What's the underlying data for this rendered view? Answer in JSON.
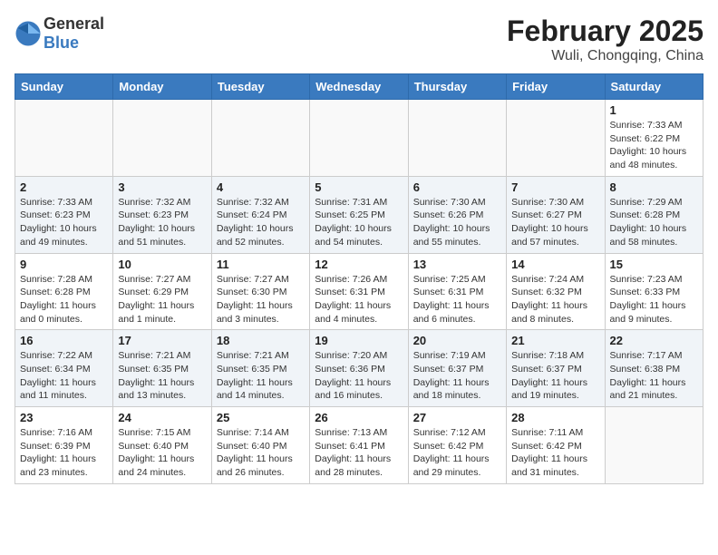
{
  "header": {
    "logo_general": "General",
    "logo_blue": "Blue",
    "month": "February 2025",
    "location": "Wuli, Chongqing, China"
  },
  "weekdays": [
    "Sunday",
    "Monday",
    "Tuesday",
    "Wednesday",
    "Thursday",
    "Friday",
    "Saturday"
  ],
  "weeks": [
    [
      {
        "day": "",
        "info": ""
      },
      {
        "day": "",
        "info": ""
      },
      {
        "day": "",
        "info": ""
      },
      {
        "day": "",
        "info": ""
      },
      {
        "day": "",
        "info": ""
      },
      {
        "day": "",
        "info": ""
      },
      {
        "day": "1",
        "info": "Sunrise: 7:33 AM\nSunset: 6:22 PM\nDaylight: 10 hours and 48 minutes."
      }
    ],
    [
      {
        "day": "2",
        "info": "Sunrise: 7:33 AM\nSunset: 6:23 PM\nDaylight: 10 hours and 49 minutes."
      },
      {
        "day": "3",
        "info": "Sunrise: 7:32 AM\nSunset: 6:23 PM\nDaylight: 10 hours and 51 minutes."
      },
      {
        "day": "4",
        "info": "Sunrise: 7:32 AM\nSunset: 6:24 PM\nDaylight: 10 hours and 52 minutes."
      },
      {
        "day": "5",
        "info": "Sunrise: 7:31 AM\nSunset: 6:25 PM\nDaylight: 10 hours and 54 minutes."
      },
      {
        "day": "6",
        "info": "Sunrise: 7:30 AM\nSunset: 6:26 PM\nDaylight: 10 hours and 55 minutes."
      },
      {
        "day": "7",
        "info": "Sunrise: 7:30 AM\nSunset: 6:27 PM\nDaylight: 10 hours and 57 minutes."
      },
      {
        "day": "8",
        "info": "Sunrise: 7:29 AM\nSunset: 6:28 PM\nDaylight: 10 hours and 58 minutes."
      }
    ],
    [
      {
        "day": "9",
        "info": "Sunrise: 7:28 AM\nSunset: 6:28 PM\nDaylight: 11 hours and 0 minutes."
      },
      {
        "day": "10",
        "info": "Sunrise: 7:27 AM\nSunset: 6:29 PM\nDaylight: 11 hours and 1 minute."
      },
      {
        "day": "11",
        "info": "Sunrise: 7:27 AM\nSunset: 6:30 PM\nDaylight: 11 hours and 3 minutes."
      },
      {
        "day": "12",
        "info": "Sunrise: 7:26 AM\nSunset: 6:31 PM\nDaylight: 11 hours and 4 minutes."
      },
      {
        "day": "13",
        "info": "Sunrise: 7:25 AM\nSunset: 6:31 PM\nDaylight: 11 hours and 6 minutes."
      },
      {
        "day": "14",
        "info": "Sunrise: 7:24 AM\nSunset: 6:32 PM\nDaylight: 11 hours and 8 minutes."
      },
      {
        "day": "15",
        "info": "Sunrise: 7:23 AM\nSunset: 6:33 PM\nDaylight: 11 hours and 9 minutes."
      }
    ],
    [
      {
        "day": "16",
        "info": "Sunrise: 7:22 AM\nSunset: 6:34 PM\nDaylight: 11 hours and 11 minutes."
      },
      {
        "day": "17",
        "info": "Sunrise: 7:21 AM\nSunset: 6:35 PM\nDaylight: 11 hours and 13 minutes."
      },
      {
        "day": "18",
        "info": "Sunrise: 7:21 AM\nSunset: 6:35 PM\nDaylight: 11 hours and 14 minutes."
      },
      {
        "day": "19",
        "info": "Sunrise: 7:20 AM\nSunset: 6:36 PM\nDaylight: 11 hours and 16 minutes."
      },
      {
        "day": "20",
        "info": "Sunrise: 7:19 AM\nSunset: 6:37 PM\nDaylight: 11 hours and 18 minutes."
      },
      {
        "day": "21",
        "info": "Sunrise: 7:18 AM\nSunset: 6:37 PM\nDaylight: 11 hours and 19 minutes."
      },
      {
        "day": "22",
        "info": "Sunrise: 7:17 AM\nSunset: 6:38 PM\nDaylight: 11 hours and 21 minutes."
      }
    ],
    [
      {
        "day": "23",
        "info": "Sunrise: 7:16 AM\nSunset: 6:39 PM\nDaylight: 11 hours and 23 minutes."
      },
      {
        "day": "24",
        "info": "Sunrise: 7:15 AM\nSunset: 6:40 PM\nDaylight: 11 hours and 24 minutes."
      },
      {
        "day": "25",
        "info": "Sunrise: 7:14 AM\nSunset: 6:40 PM\nDaylight: 11 hours and 26 minutes."
      },
      {
        "day": "26",
        "info": "Sunrise: 7:13 AM\nSunset: 6:41 PM\nDaylight: 11 hours and 28 minutes."
      },
      {
        "day": "27",
        "info": "Sunrise: 7:12 AM\nSunset: 6:42 PM\nDaylight: 11 hours and 29 minutes."
      },
      {
        "day": "28",
        "info": "Sunrise: 7:11 AM\nSunset: 6:42 PM\nDaylight: 11 hours and 31 minutes."
      },
      {
        "day": "",
        "info": ""
      }
    ]
  ]
}
